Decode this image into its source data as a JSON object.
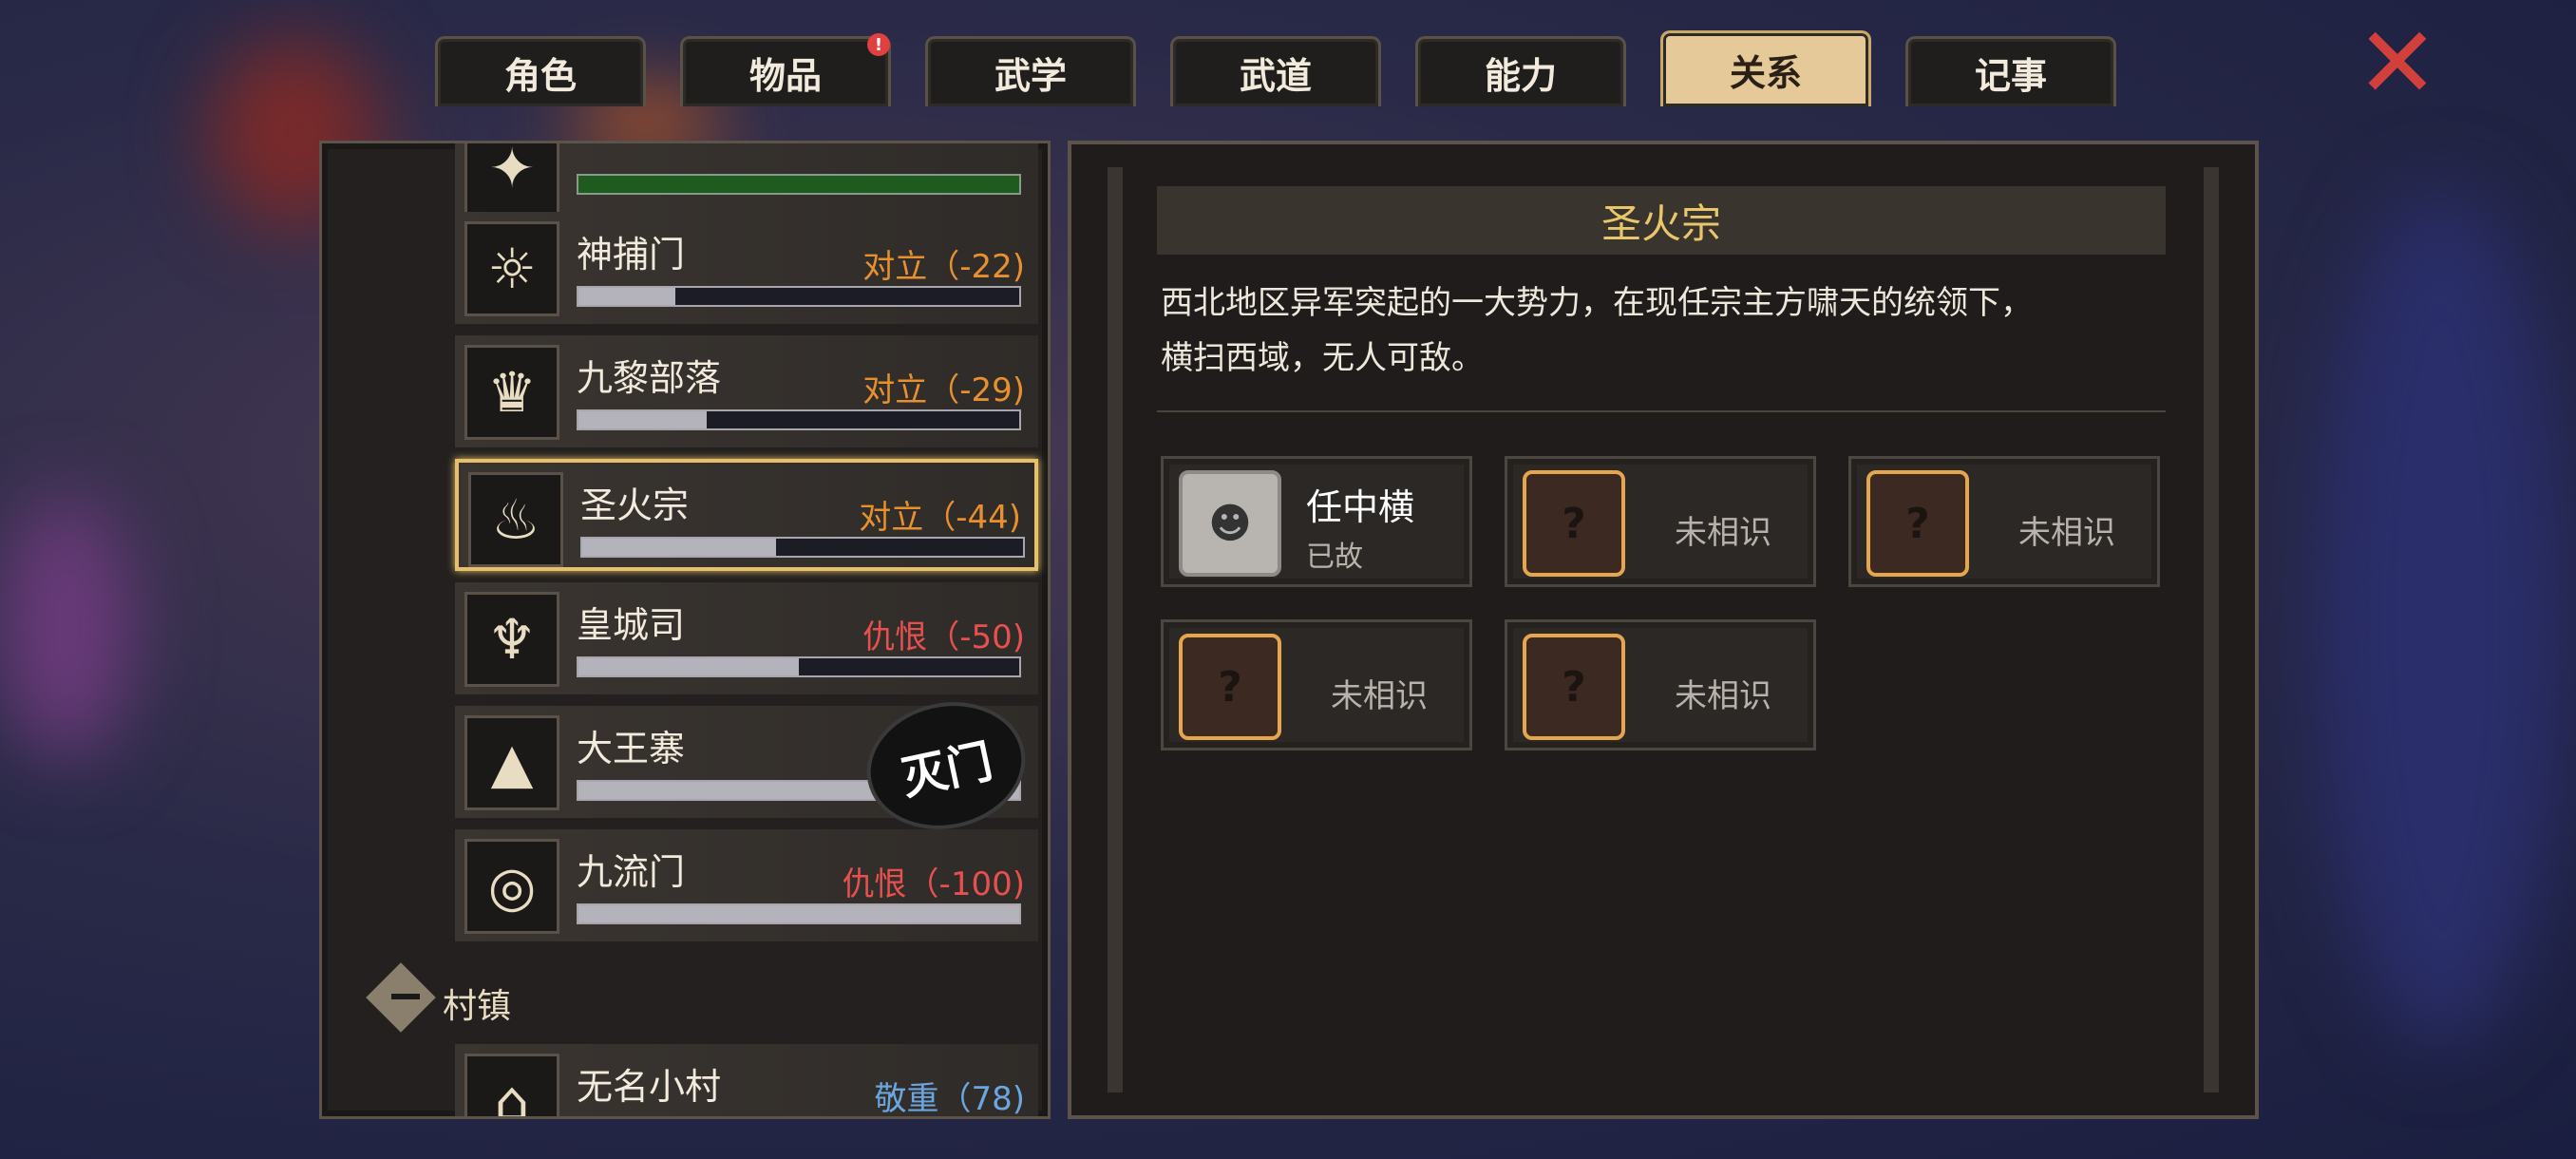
{
  "tabs": [
    {
      "label": "角色"
    },
    {
      "label": "物品",
      "badge": "!"
    },
    {
      "label": "武学"
    },
    {
      "label": "武道"
    },
    {
      "label": "能力"
    },
    {
      "label": "关系",
      "active": true
    },
    {
      "label": "记事"
    }
  ],
  "close_icon": "close-x-icon",
  "factions": [
    {
      "name": "神捕门",
      "status": "对立（-22)",
      "progress": 0.22,
      "status_color": "#e8902e"
    },
    {
      "name": "九黎部落",
      "status": "对立（-29)",
      "progress": 0.29,
      "status_color": "#e8902e"
    },
    {
      "name": "圣火宗",
      "status": "对立（-44)",
      "progress": 0.44,
      "status_color": "#e8902e",
      "selected": true
    },
    {
      "name": "皇城司",
      "status": "仇恨（-50)",
      "progress": 0.5,
      "status_color": "#e85050"
    },
    {
      "name": "大王寨",
      "status": "",
      "progress": 1.0,
      "seal": "灭门"
    },
    {
      "name": "九流门",
      "status": "仇恨（-100)",
      "progress": 1.0,
      "status_color": "#e85050"
    }
  ],
  "category": {
    "label": "村镇"
  },
  "village": {
    "name": "无名小村",
    "status": "敬重（78)",
    "status_color": "#6aa6e0"
  },
  "detail": {
    "title": "圣火宗",
    "description_lines": [
      "西北地区异军突起的一大势力，在现任宗主方啸天的统领下，",
      "横扫西域，无人可敌。"
    ],
    "members": [
      {
        "name": "任中横",
        "sub": "已故",
        "known": true
      },
      {
        "label": "未相识",
        "known": false
      },
      {
        "label": "未相识",
        "known": false
      },
      {
        "label": "未相识",
        "known": false
      },
      {
        "label": "未相识",
        "known": false
      }
    ]
  },
  "colors": {
    "accent": "#e6c06a",
    "panel": "#23201f",
    "title": "#e8c66a"
  }
}
